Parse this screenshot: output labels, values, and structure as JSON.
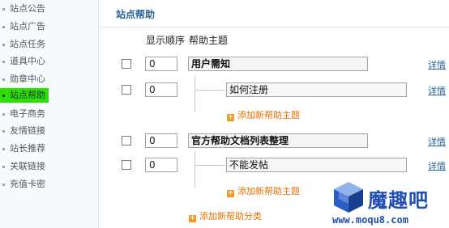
{
  "sidebar": {
    "items": [
      {
        "label": "站点公告"
      },
      {
        "label": "站点广告"
      },
      {
        "label": "站点任务"
      },
      {
        "label": "道具中心"
      },
      {
        "label": "勋章中心"
      },
      {
        "label": "站点帮助",
        "active": true
      },
      {
        "label": "电子商务"
      },
      {
        "label": "友情链接"
      },
      {
        "label": "站长推荐"
      },
      {
        "label": "关联链接"
      },
      {
        "label": "充值卡密"
      }
    ]
  },
  "main": {
    "title": "站点帮助",
    "headers": {
      "order": "显示顺序",
      "topic": "帮助主题"
    },
    "rows": [
      {
        "order": "0",
        "topic": "用户需知",
        "detail": "详情"
      },
      {
        "order": "0",
        "topic": "如何注册",
        "detail": "详情"
      },
      {
        "add_topic": "添加新帮助主题"
      },
      {
        "order": "0",
        "topic": "官方帮助文档列表整理",
        "detail": "详情"
      },
      {
        "order": "0",
        "topic": "不能发帖",
        "detail": "详情"
      },
      {
        "add_topic": "添加新帮助主题"
      }
    ],
    "add_category": "添加新帮助分类"
  },
  "watermark": {
    "text": "魔趣吧",
    "url": "www.moqu8.com"
  },
  "colors": {
    "active_item": "#2ee000",
    "link": "#2a6496",
    "add_link": "#e57100",
    "brand": "#1f4fb0"
  }
}
